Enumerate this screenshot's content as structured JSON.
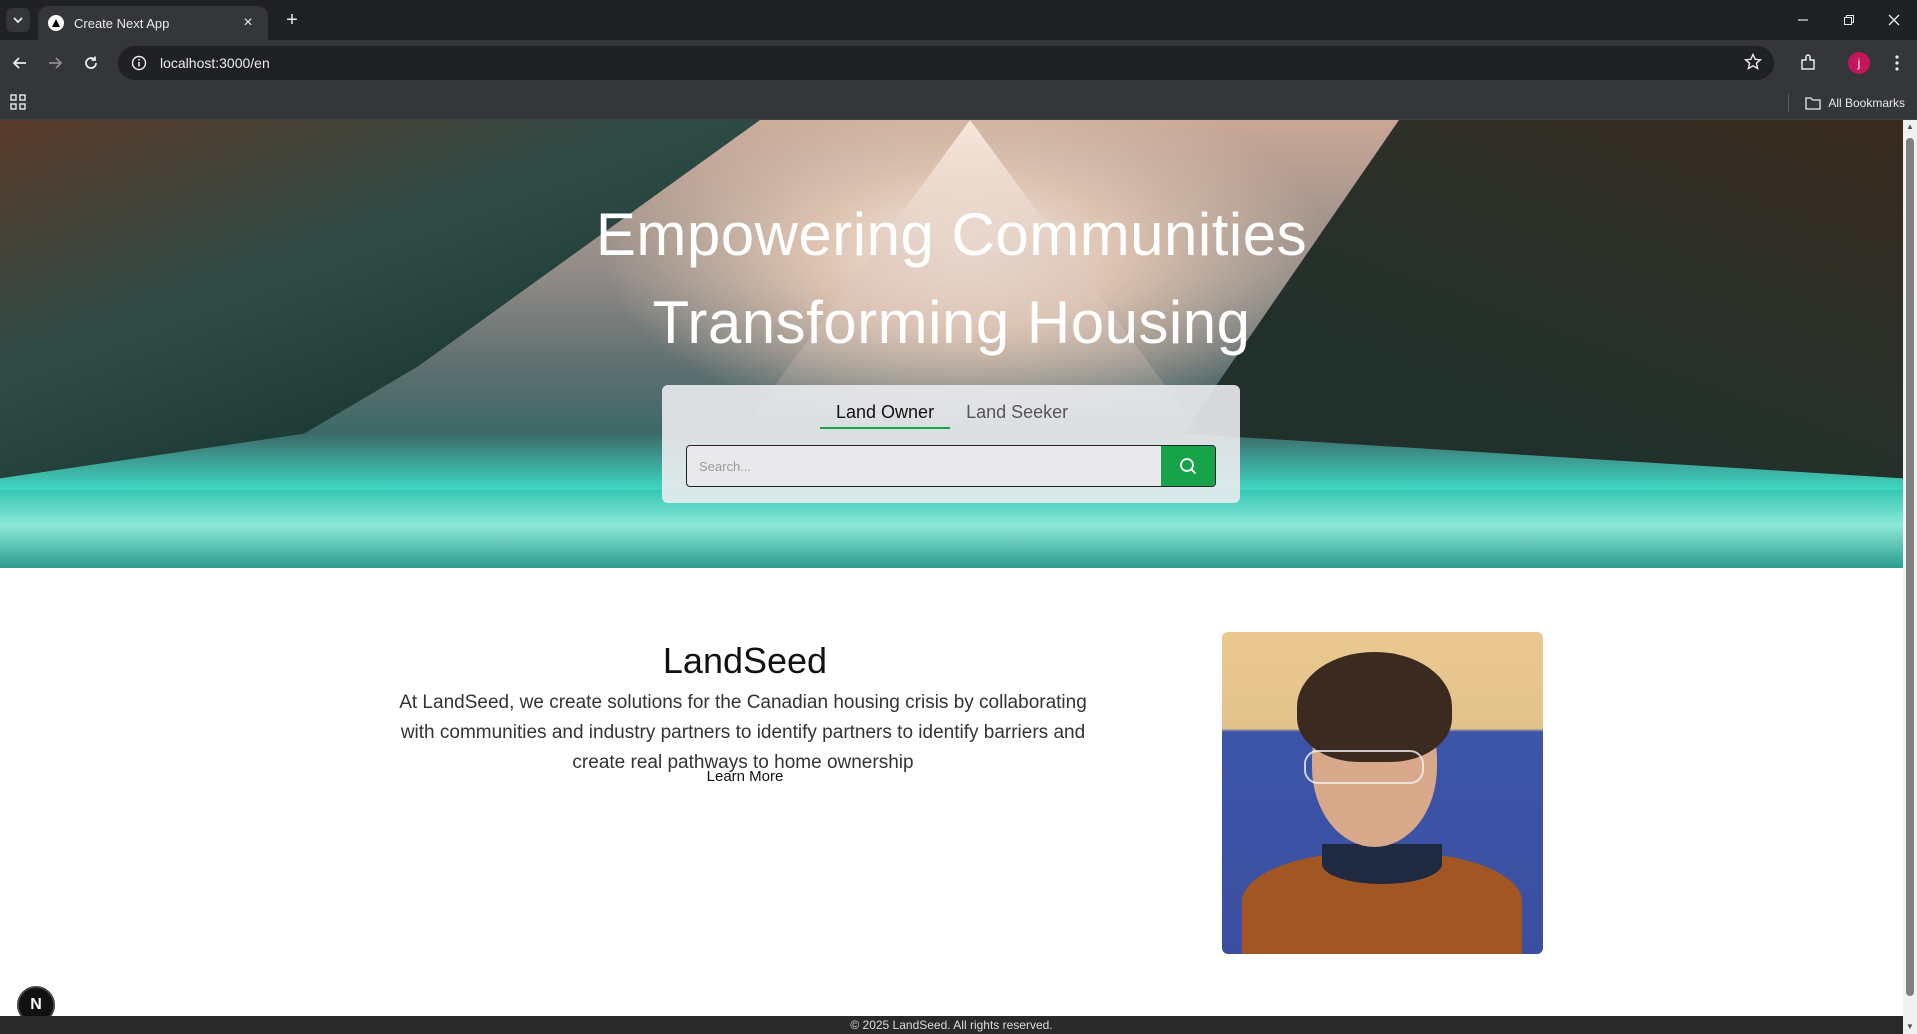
{
  "browser": {
    "tab_title": "Create Next App",
    "url": "localhost:3000/en",
    "bookmarks_label": "All Bookmarks",
    "profile_initial": "j"
  },
  "hero": {
    "line1": "Empowering Communities",
    "line2": "Transforming Housing",
    "tabs": [
      {
        "label": "Land Owner",
        "active": true
      },
      {
        "label": "Land Seeker",
        "active": false
      }
    ],
    "search_placeholder": "Search..."
  },
  "about": {
    "title": "LandSeed",
    "text": "At LandSeed, we create solutions for the Canadian housing crisis by collaborating with communities and industry partners to identify partners to identify barriers and create real pathways to home ownership",
    "learn_more": "Learn More"
  },
  "footer": {
    "text": "© 2025 LandSeed. All rights reserved."
  },
  "next_badge": "N",
  "colors": {
    "accent": "#16a34a"
  }
}
